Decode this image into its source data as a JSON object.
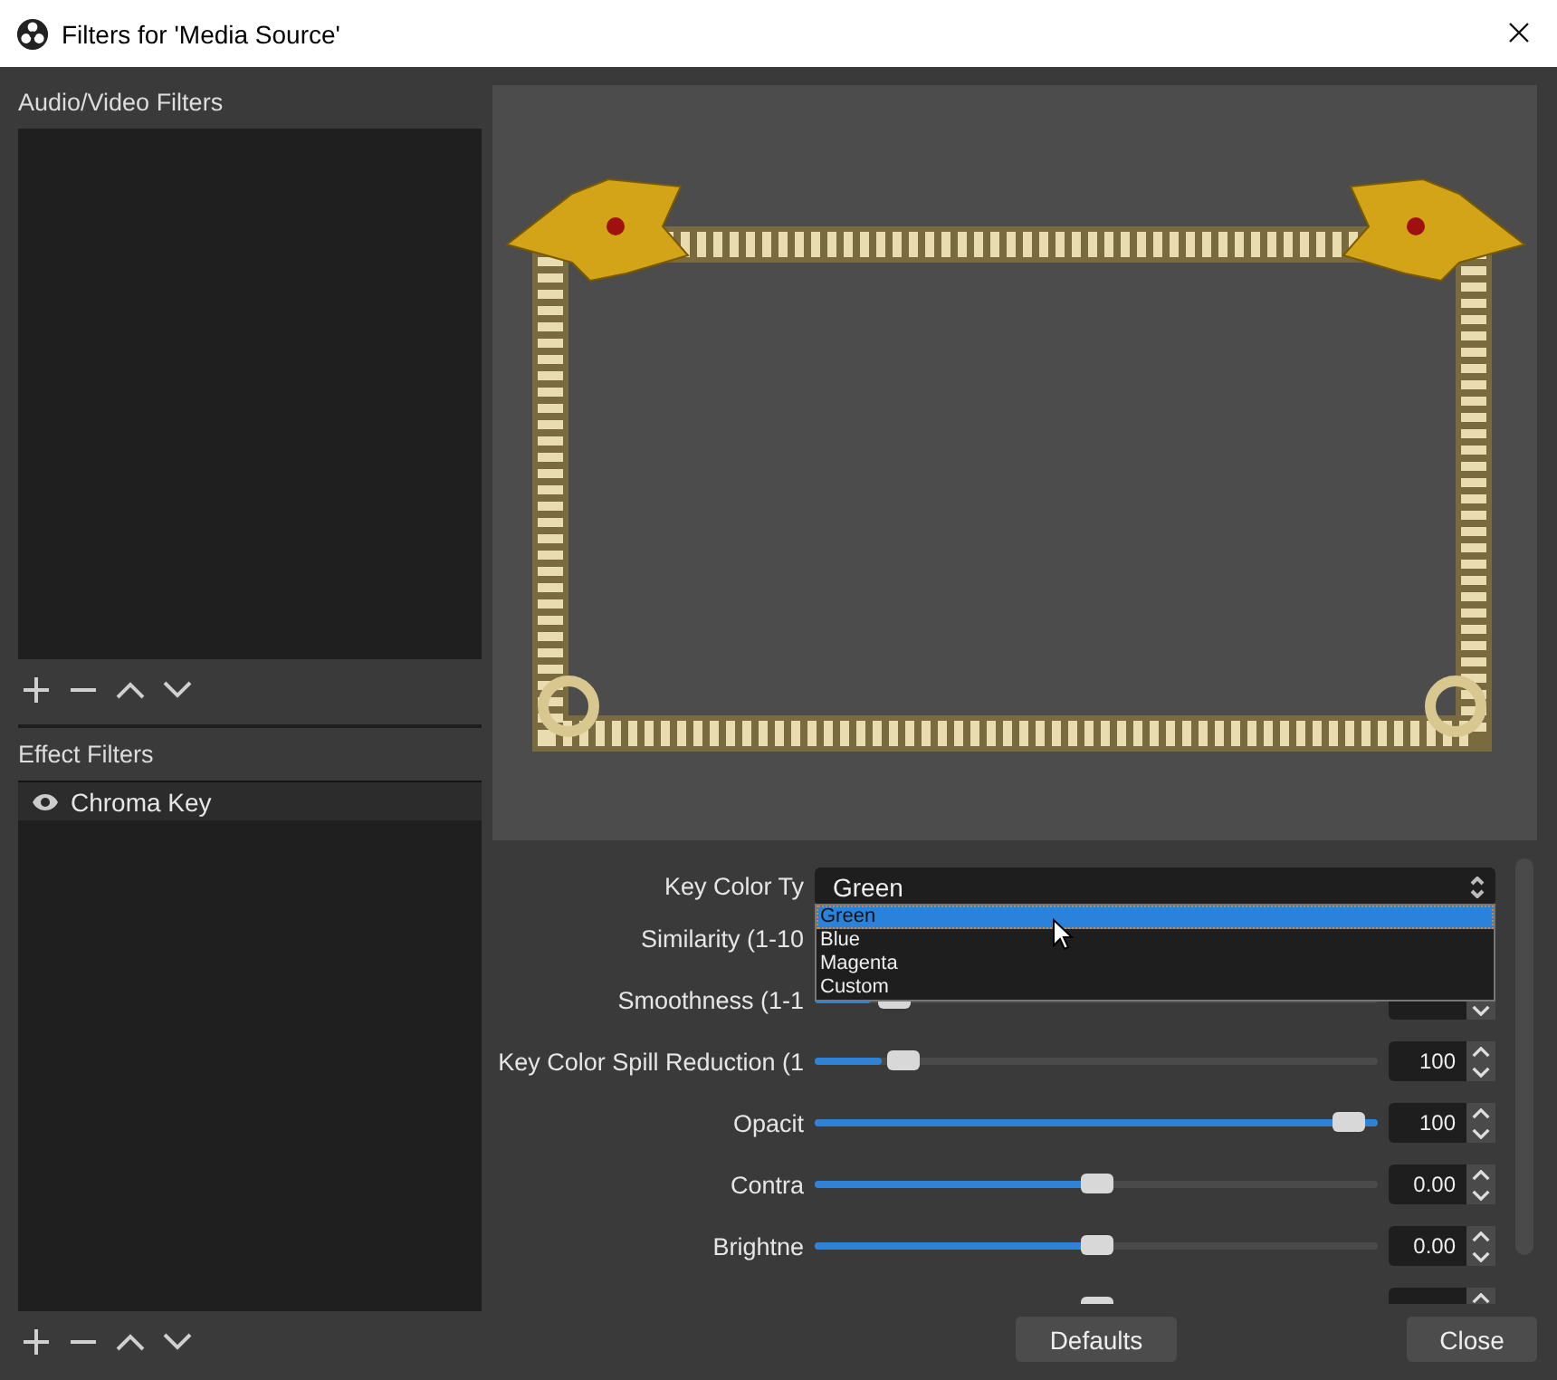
{
  "window": {
    "title": "Filters for 'Media Source'"
  },
  "audio_video_filters": {
    "label": "Audio/Video Filters"
  },
  "effect_filters": {
    "label": "Effect Filters",
    "items": [
      {
        "name": "Chroma Key",
        "visible": true,
        "selected": true
      }
    ]
  },
  "properties": [
    {
      "kind": "combo",
      "label": "Key Color Ty",
      "value": "Green",
      "expanded": true,
      "options": [
        {
          "label": "Green",
          "selected": true
        },
        {
          "label": "Blue",
          "selected": false
        },
        {
          "label": "Magenta",
          "selected": false
        },
        {
          "label": "Custom",
          "selected": false
        }
      ]
    },
    {
      "kind": "slider",
      "label": "Similarity (1-10"
    },
    {
      "kind": "slider",
      "label": "Smoothness (1-1",
      "level": 0.1
    },
    {
      "kind": "slider",
      "label": "Key Color Spill Reduction (1",
      "level": 0.12,
      "value": "100"
    },
    {
      "kind": "slider",
      "label": "Opacit",
      "level": 1,
      "value": "100"
    },
    {
      "kind": "slider",
      "label": "Contra",
      "level": 0.5,
      "value": "0.00"
    },
    {
      "kind": "slider",
      "label": "Brightne",
      "level": 0.5,
      "value": "0.00"
    },
    {
      "kind": "slider",
      "level": 0.5
    }
  ],
  "buttons": [
    "Defaults",
    "Close"
  ]
}
